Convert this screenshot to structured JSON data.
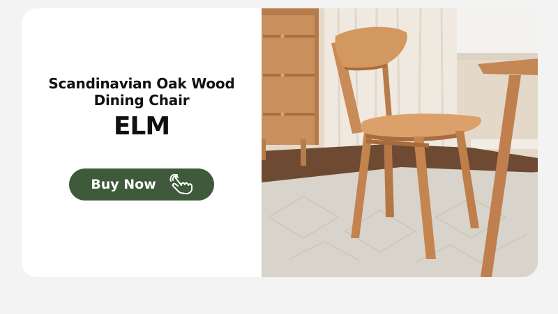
{
  "banner": {
    "subtitle_line1": "Scandinavian Oak Wood",
    "subtitle_line2": "Dining Chair",
    "brand": "ELM",
    "cta_label": "Buy Now",
    "cta_icon": "hand-pointer-icon",
    "cta_color": "#3e5a3a",
    "photo": "oak-dining-chair-photo"
  }
}
